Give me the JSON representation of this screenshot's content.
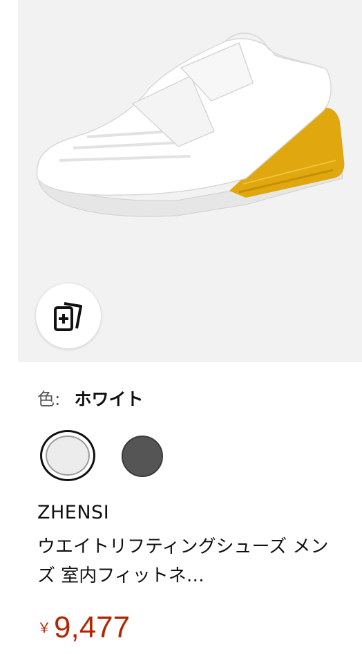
{
  "color": {
    "label": "色:",
    "selected": "ホワイト",
    "swatches": [
      {
        "name": "white",
        "color": "#ececec",
        "selected": true
      },
      {
        "name": "dark-gray",
        "color": "#555555",
        "selected": false
      }
    ]
  },
  "product": {
    "brand": "ZHENSI",
    "title": "ウエイトリフティングシューズ メンズ 室内フィットネ…",
    "price_symbol": "￥",
    "price": "9,477"
  },
  "icons": {
    "compare": "add-to-compare-cards-icon"
  },
  "colors": {
    "price": "#b12704",
    "image_background": "#f2f2f2",
    "shoe_accent": "#e0a80e"
  }
}
